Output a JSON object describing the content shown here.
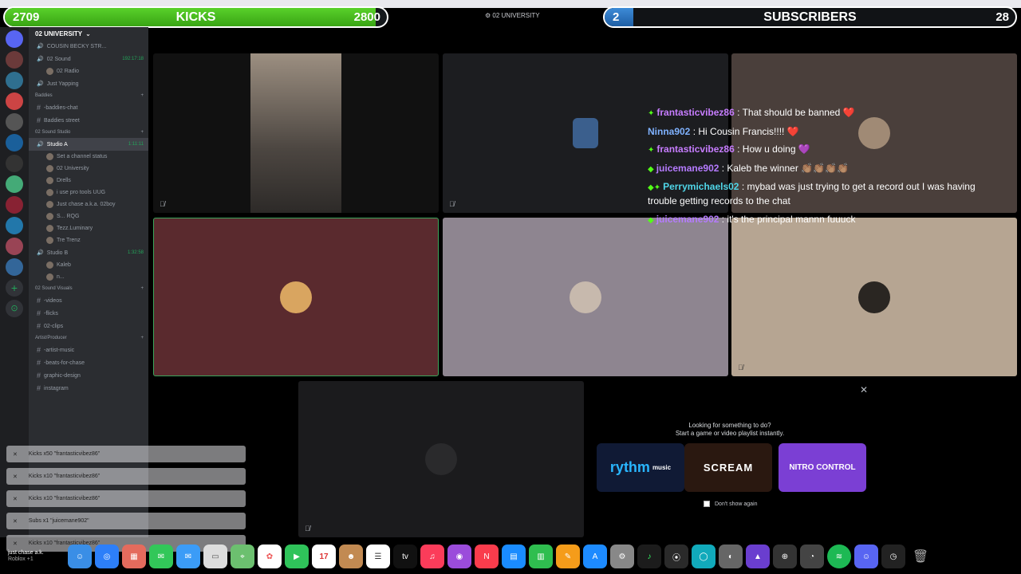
{
  "kicks_goal": {
    "current": "2709",
    "label": "KICKS",
    "target": "2800",
    "progress": 0.97
  },
  "subs_goal": {
    "current": "2",
    "label": "SUBSCRIBERS",
    "target": "28",
    "progress": 0.07
  },
  "server_title_top": "02 UNIVERSITY",
  "sidebar": {
    "server_name": "02 UNIVERSITY",
    "rows": [
      {
        "type": "voice",
        "label": "COUSIN BECKY STR..."
      },
      {
        "type": "voice",
        "label": "02 Sound",
        "time": "192:17:18"
      },
      {
        "type": "sub",
        "label": "02 Radio"
      },
      {
        "type": "voice",
        "label": "Just Yapping"
      },
      {
        "type": "cat",
        "label": "Baddies"
      },
      {
        "type": "text",
        "label": "-baddies-chat"
      },
      {
        "type": "text",
        "label": "Baddies street"
      },
      {
        "type": "cat",
        "label": "02 Sound Studio"
      },
      {
        "type": "voice",
        "label": "Studio A",
        "time": "1:11:11",
        "active": true
      },
      {
        "type": "sub",
        "label": "Set a channel status"
      },
      {
        "type": "sub",
        "label": "02 University"
      },
      {
        "type": "sub",
        "label": "Drells"
      },
      {
        "type": "sub",
        "label": "i use pro tools  UUG"
      },
      {
        "type": "sub",
        "label": "Just chase a.k.a. 02boy"
      },
      {
        "type": "sub",
        "label": "S... RQG"
      },
      {
        "type": "sub",
        "label": "Tezz.Luminary"
      },
      {
        "type": "sub",
        "label": "Tre Trenz"
      },
      {
        "type": "voice",
        "label": "Studio B",
        "time": "1:32:58"
      },
      {
        "type": "sub",
        "label": "Kaleb"
      },
      {
        "type": "sub",
        "label": "n..."
      },
      {
        "type": "cat",
        "label": "02 Sound Visuals"
      },
      {
        "type": "text",
        "label": "-videos"
      },
      {
        "type": "text",
        "label": "-flicks"
      },
      {
        "type": "text",
        "label": "02-clips"
      },
      {
        "type": "cat",
        "label": "Artist/Producer"
      },
      {
        "type": "text",
        "label": "-artist-music"
      },
      {
        "type": "text",
        "label": "-beats-for-chase"
      },
      {
        "type": "text",
        "label": "graphic-design"
      },
      {
        "type": "text",
        "label": "instagram"
      }
    ]
  },
  "chat": [
    {
      "badge": "✦",
      "user": "frantasticvibez86",
      "color": "#c77dff",
      "text": " : That should be banned ❤️"
    },
    {
      "badge": "",
      "user": "Ninna902",
      "color": "#7fb2ff",
      "text": " : Hi Cousin Francis!!!! ❤️"
    },
    {
      "badge": "✦",
      "user": "frantasticvibez86",
      "color": "#c77dff",
      "text": " : How u doing 💜"
    },
    {
      "badge": "◆",
      "user": "juicemane902",
      "color": "#b57bff",
      "text": " : Kaleb the winner 👏🏽👏🏽👏🏽👏🏽"
    },
    {
      "badge": "◆✦",
      "user": "Perrymichaels02",
      "color": "#4fd6e8",
      "text": " : mybad was just trying to get a record out I was having trouble getting records to the chat"
    },
    {
      "badge": "◆",
      "user": "juicemane902",
      "color": "#b57bff",
      "text": " : it's the principal mannn fuuuck"
    }
  ],
  "activity": {
    "title_line1": "Looking for something to do?",
    "title_line2": "Start a game or video playlist instantly.",
    "card1": "rythm",
    "card1_sub": "music",
    "card2": "SCREAM",
    "card3": "NITRO CONTROL",
    "dont_show": "Don't show again"
  },
  "notifications": [
    "Kicks x50 \"frantasticvibez86\"",
    "Kicks x10 \"frantasticvibez86\"",
    "Kicks x10 \"frantasticvibez86\"",
    "Subs x1 \"juicemane902\"",
    "Kicks x10 \"frantasticvibez86\""
  ],
  "user_panel": {
    "name": "just chase a.k.",
    "status": "Roblox +1"
  },
  "calendar_day": "17",
  "colors": {
    "kicks_green": "#53fc18",
    "subs_blue": "#2f78c4",
    "tile_maroon": "#5a2a2e",
    "tile_lilac": "#8e8590",
    "tile_tan": "#b6a592"
  }
}
